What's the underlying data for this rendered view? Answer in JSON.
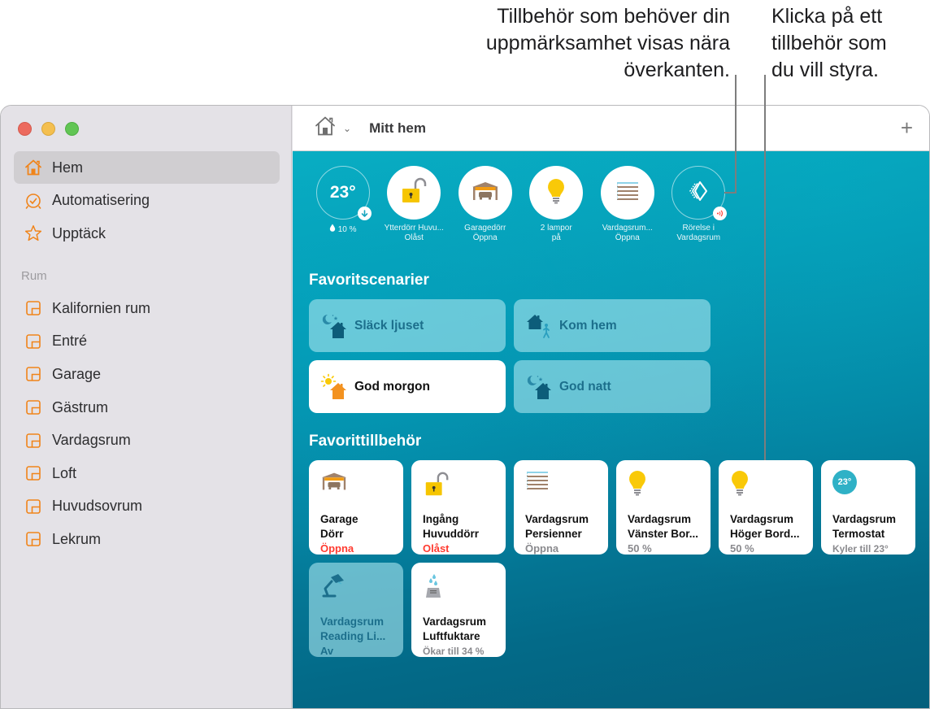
{
  "callouts": {
    "attention": [
      "Tillbehör som behöver din",
      "uppmärksamhet visas nära",
      "överkanten."
    ],
    "control": [
      "Klicka på ett",
      "tillbehör som",
      "du vill styra."
    ]
  },
  "colors": {
    "accent": "#f0841a",
    "alert": "#ff3b30",
    "scene_text": "#1c6f8c",
    "thermostat": "#2fb1c6"
  },
  "sidebar": {
    "nav": [
      {
        "label": "Hem",
        "icon": "house-icon",
        "active": true
      },
      {
        "label": "Automatisering",
        "icon": "alarm-clock-icon",
        "active": false
      },
      {
        "label": "Upptäck",
        "icon": "star-icon",
        "active": false
      }
    ],
    "rooms_label": "Rum",
    "rooms": [
      "Kalifornien rum",
      "Entré",
      "Garage",
      "Gästrum",
      "Vardagsrum",
      "Loft",
      "Huvudsovrum",
      "Lekrum"
    ]
  },
  "toolbar": {
    "title": "Mitt hem",
    "add_symbol": "+"
  },
  "status": [
    {
      "id": "thermostat",
      "value": "23°",
      "line1": "10 %",
      "line2": ""
    },
    {
      "id": "lock",
      "line1": "Ytterdörr Huvu...",
      "line2": "Olåst"
    },
    {
      "id": "garage",
      "line1": "Garagedörr",
      "line2": "Öppna"
    },
    {
      "id": "lights",
      "line1": "2 lampor",
      "line2": "på"
    },
    {
      "id": "blinds",
      "line1": "Vardagsrum...",
      "line2": "Öppna"
    },
    {
      "id": "motion",
      "line1": "Rörelse i",
      "line2": "Vardagsrum"
    }
  ],
  "scenes": {
    "title": "Favoritscenarier",
    "items": [
      {
        "label": "Släck ljuset",
        "icon": "night-house-icon",
        "on": false
      },
      {
        "label": "Kom hem",
        "icon": "arrive-home-icon",
        "on": false
      },
      {
        "label": "God morgon",
        "icon": "morning-house-icon",
        "on": true
      },
      {
        "label": "God natt",
        "icon": "night-house-icon",
        "on": false
      }
    ]
  },
  "accessories": {
    "title": "Favorittillbehör",
    "items": [
      {
        "name1": "Garage",
        "name2": "Dörr",
        "status": "Öppna",
        "alert": true,
        "icon": "garage-icon"
      },
      {
        "name1": "Ingång",
        "name2": "Huvuddörr",
        "status": "Olåst",
        "alert": true,
        "icon": "unlocked-lock-icon"
      },
      {
        "name1": "Vardagsrum",
        "name2": "Persienner",
        "status": "Öppna",
        "alert": false,
        "icon": "blinds-icon"
      },
      {
        "name1": "Vardagsrum",
        "name2": "Vänster Bor...",
        "status": "50 %",
        "alert": false,
        "icon": "lightbulb-icon"
      },
      {
        "name1": "Vardagsrum",
        "name2": "Höger Bord...",
        "status": "50 %",
        "alert": false,
        "icon": "lightbulb-icon"
      },
      {
        "name1": "Vardagsrum",
        "name2": "Termostat",
        "status": "Kyler till 23°",
        "alert": false,
        "icon": "thermostat-icon",
        "badge": "23°"
      },
      {
        "name1": "Vardagsrum",
        "name2": "Reading Li...",
        "status": "Av",
        "alert": false,
        "icon": "desk-lamp-icon",
        "off": true
      },
      {
        "name1": "Vardagsrum",
        "name2": "Luftfuktare",
        "status": "Ökar till 34 %",
        "alert": false,
        "icon": "humidifier-icon"
      }
    ]
  }
}
